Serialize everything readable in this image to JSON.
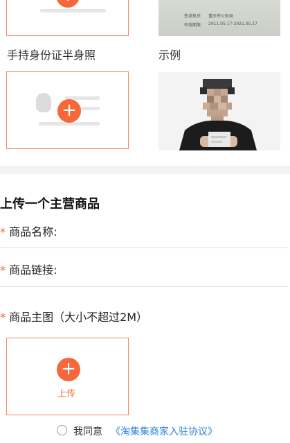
{
  "id_section": {
    "handheld_caption": "手持身份证半身照",
    "example_caption": "示例",
    "upload_icon": "plus-icon",
    "id_card_sample": {
      "authority_label": "签发机关",
      "authority_value": "重庆市公安局",
      "validity_label": "有效期限",
      "validity_value": "2011.05.17-2021.05.17"
    }
  },
  "product_section": {
    "title": "上传一个主营商品",
    "required_mark": "*",
    "name_label": "商品名称:",
    "link_label": "商品链接:",
    "image_label": "商品主图（大小不超过2M）",
    "upload_label": "上传",
    "upload_icon": "plus-icon"
  },
  "agreement": {
    "prefix": "我同意",
    "link_text": "《淘集集商家入驻协议》",
    "checked": false
  },
  "colors": {
    "accent": "#f4683a",
    "link": "#2f86d6",
    "box_border": "#f58a5b"
  }
}
